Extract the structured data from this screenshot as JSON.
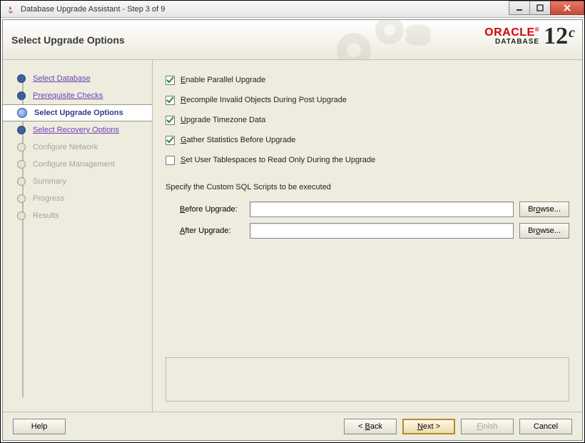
{
  "window": {
    "title": "Database Upgrade Assistant - Step 3 of 9"
  },
  "header": {
    "title": "Select Upgrade Options",
    "brand_top": "ORACLE",
    "brand_sub": "DATABASE",
    "version_num": "12",
    "version_suffix": "c"
  },
  "sidebar": {
    "steps": [
      {
        "label": "Select Database",
        "state": "done",
        "link": true
      },
      {
        "label": "Prerequisite Checks",
        "state": "done",
        "link": true
      },
      {
        "label": "Select Upgrade Options",
        "state": "current",
        "link": true
      },
      {
        "label": "Select Recovery Options",
        "state": "done",
        "link": true
      },
      {
        "label": "Configure Network",
        "state": "future",
        "link": false
      },
      {
        "label": "Configure Management",
        "state": "future",
        "link": false
      },
      {
        "label": "Summary",
        "state": "future",
        "link": false
      },
      {
        "label": "Progress",
        "state": "future",
        "link": false
      },
      {
        "label": "Results",
        "state": "future",
        "link": false
      }
    ]
  },
  "options": {
    "enable_parallel": {
      "label": "Enable Parallel Upgrade",
      "checked": true,
      "mnem": "E"
    },
    "recompile": {
      "label": "Recompile Invalid Objects During Post Upgrade",
      "checked": true,
      "mnem": "R"
    },
    "timezone": {
      "label": "Upgrade Timezone Data",
      "checked": true,
      "mnem": "U"
    },
    "gather_stats": {
      "label": "Gather Statistics Before Upgrade",
      "checked": true,
      "mnem": "G"
    },
    "readonly_ts": {
      "label": "Set User Tablespaces to Read Only During the Upgrade",
      "checked": false,
      "mnem": "S"
    }
  },
  "scripts": {
    "heading": "Specify the Custom SQL Scripts to be executed",
    "before_label": "Before Upgrade:",
    "before_mnem": "B",
    "before_value": "",
    "after_label": "After Upgrade:",
    "after_mnem": "A",
    "after_value": "",
    "browse_label": "Browse...",
    "browse_mnem": "o"
  },
  "footer": {
    "help": "Help",
    "back": "< Back",
    "next": "Next >",
    "finish": "Finish",
    "cancel": "Cancel",
    "back_mnem": "B",
    "next_mnem": "N",
    "finish_mnem": "F"
  }
}
